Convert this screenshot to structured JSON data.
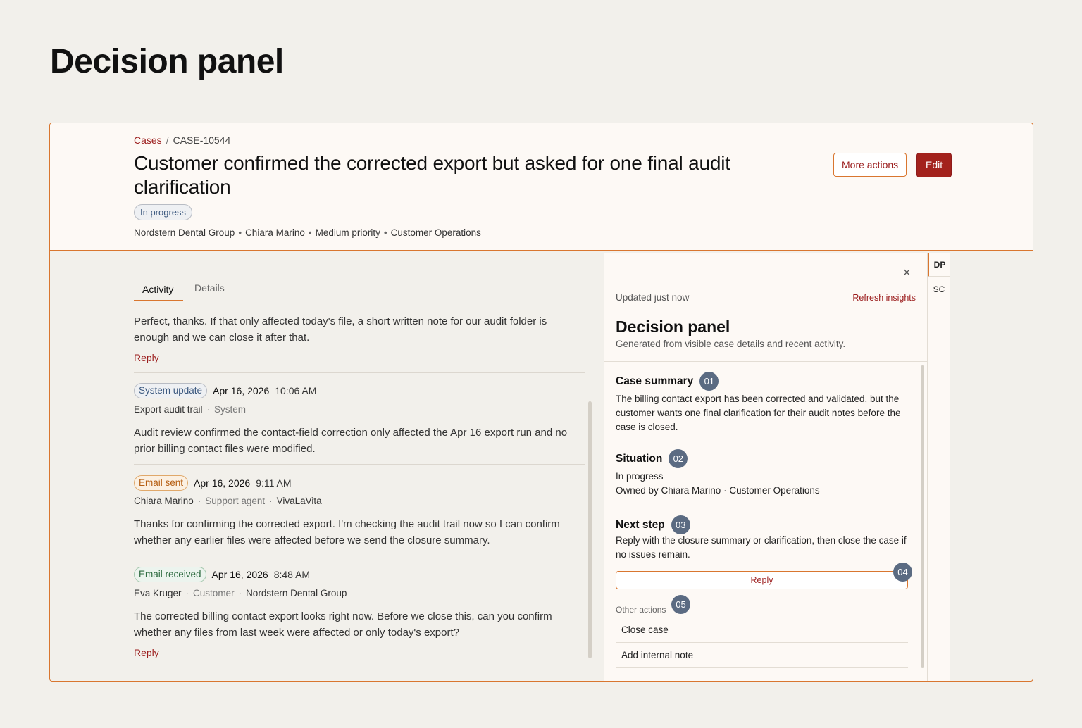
{
  "page": {
    "title": "Decision panel"
  },
  "header": {
    "breadcrumb": {
      "root": "Cases",
      "separator": "/",
      "current": "CASE-10544"
    },
    "title": "Customer confirmed the corrected export but asked for one final audit clarification",
    "status": "In progress",
    "meta": [
      "Nordstern Dental Group",
      "Chiara Marino",
      "Medium priority",
      "Customer Operations"
    ],
    "meta_separator": "•",
    "more_actions_label": "More actions",
    "edit_label": "Edit"
  },
  "tabs": [
    {
      "label": "Activity",
      "active": true
    },
    {
      "label": "Details",
      "active": false
    }
  ],
  "activity": {
    "top_entry": {
      "text": "Perfect, thanks. If that only affected today's file, a short written note for our audit folder is enough and we can close it after that.",
      "reply_label": "Reply"
    },
    "entries": [
      {
        "type_label": "System update",
        "type": "system",
        "date": "Apr 16, 2026",
        "time": "10:06 AM",
        "author": "Export audit trail",
        "role": "System",
        "org": "",
        "text": "Audit review confirmed the contact-field correction only affected the Apr 16 export run and no prior billing contact files were modified."
      },
      {
        "type_label": "Email sent",
        "type": "sent",
        "date": "Apr 16, 2026",
        "time": "9:11 AM",
        "author": "Chiara Marino",
        "role": "Support agent",
        "org": "VivaLaVita",
        "text": "Thanks for confirming the corrected export. I'm checking the audit trail now so I can confirm whether any earlier files were affected before we send the closure summary."
      },
      {
        "type_label": "Email received",
        "type": "received",
        "date": "Apr 16, 2026",
        "time": "8:48 AM",
        "author": "Eva Kruger",
        "role": "Customer",
        "org": "Nordstern Dental Group",
        "text": "The corrected billing contact export looks right now. Before we close this, can you confirm whether any files from last week were affected or only today's export?",
        "reply_label": "Reply"
      }
    ],
    "meta_separator": "·"
  },
  "decision_panel": {
    "close_glyph": "×",
    "updated": "Updated just now",
    "refresh_label": "Refresh insights",
    "title": "Decision panel",
    "subtitle": "Generated from visible case details and recent activity.",
    "case_summary": {
      "title": "Case summary",
      "badge": "01",
      "text": "The billing contact export has been corrected and validated, but the customer wants one final clarification for their audit notes before the case is closed."
    },
    "situation": {
      "title": "Situation",
      "badge": "02",
      "line1": "In progress",
      "line2": "Owned by Chiara Marino · Customer Operations"
    },
    "next_step": {
      "title": "Next step",
      "badge": "03",
      "text": "Reply with the closure summary or clarification, then close the case if no issues remain.",
      "reply_label": "Reply",
      "reply_badge": "04"
    },
    "other_actions": {
      "label": "Other actions",
      "badge": "05",
      "items": [
        "Close case",
        "Add internal note"
      ]
    }
  },
  "rail": {
    "items": [
      {
        "label": "DP",
        "active": true
      },
      {
        "label": "SC",
        "active": false
      }
    ]
  },
  "colors": {
    "accent": "#d9762f",
    "brand_red": "#a3221c",
    "link_red": "#9b1c1c",
    "badge": "#5b6b82",
    "background": "#f2f0eb",
    "panel": "#fdf9f5"
  }
}
